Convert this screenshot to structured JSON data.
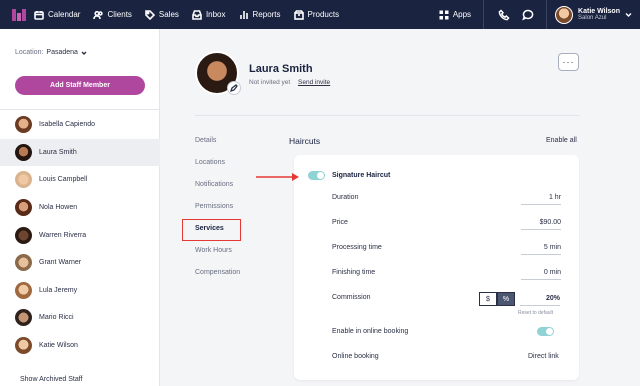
{
  "nav": {
    "items": [
      {
        "label": "Calendar",
        "icon": "calendar-icon"
      },
      {
        "label": "Clients",
        "icon": "clients-icon"
      },
      {
        "label": "Sales",
        "icon": "tag-icon"
      },
      {
        "label": "Inbox",
        "icon": "inbox-icon"
      },
      {
        "label": "Reports",
        "icon": "bar-chart-icon"
      },
      {
        "label": "Products",
        "icon": "box-icon"
      }
    ],
    "apps_label": "Apps",
    "user_name": "Katie Wilson",
    "user_location": "Salon Azul"
  },
  "sidebar": {
    "location_label": "Location:",
    "location_value": "Pasadena",
    "add_button": "Add Staff Member",
    "staff": [
      {
        "name": "Isabella Capiendo",
        "active": false
      },
      {
        "name": "Laura Smith",
        "active": true
      },
      {
        "name": "Louis Campbell",
        "active": false
      },
      {
        "name": "Nola Howen",
        "active": false
      },
      {
        "name": "Warren Riverra",
        "active": false
      },
      {
        "name": "Grant Warner",
        "active": false
      },
      {
        "name": "Lula Jeremy",
        "active": false
      },
      {
        "name": "Mario Ricci",
        "active": false
      },
      {
        "name": "Katie Wilson",
        "active": false
      }
    ],
    "show_archived": "Show Archived Staff"
  },
  "profile": {
    "name": "Laura Smith",
    "invite_status": "Not invited yet",
    "send_invite": "Send invite",
    "more": "···"
  },
  "tabs": [
    "Details",
    "Locations",
    "Notifications",
    "Permissions",
    "Services",
    "Work Hours",
    "Compensation"
  ],
  "active_tab": "Services",
  "services": {
    "section_title": "Haircuts",
    "enable_all": "Enable all",
    "service": {
      "name": "Signature Haircut",
      "enabled": true,
      "rows": [
        {
          "label": "Duration",
          "value": "1 hr"
        },
        {
          "label": "Price",
          "value": "$90.00"
        },
        {
          "label": "Processing time",
          "value": "5 min"
        },
        {
          "label": "Finishing time",
          "value": "0 min"
        }
      ],
      "commission": {
        "label": "Commission",
        "dollar": "$",
        "percent": "%",
        "selected": "%",
        "value": "20%",
        "reset": "Reset to default"
      },
      "online_booking_enable_label": "Enable in online booking",
      "online_booking_enabled": true,
      "online_booking_label": "Online booking",
      "online_booking_value": "Direct link"
    }
  },
  "colors": {
    "nav_bg": "#1a2340",
    "accent": "#b0479f",
    "toggle_on": "#8fd3d4",
    "highlight": "#e53935"
  }
}
